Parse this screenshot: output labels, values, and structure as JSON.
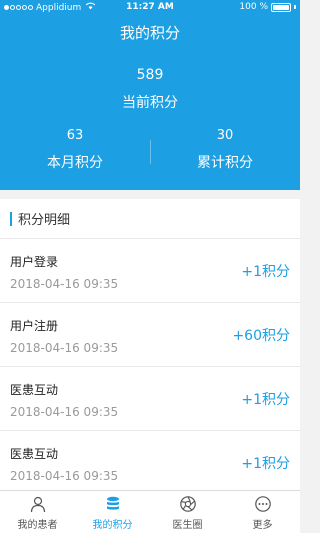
{
  "status_bar": {
    "carrier": "Applidium",
    "time": "11:27 AM",
    "battery_text": "100 %",
    "battery_level": 1.0
  },
  "header": {
    "title": "我的积分",
    "total_value": "589",
    "total_label": "当前积分",
    "monthly": {
      "value": "63",
      "label": "本月积分"
    },
    "cumulative": {
      "value": "30",
      "label": "累计积分"
    }
  },
  "details": {
    "section_title": "积分明细",
    "records": [
      {
        "type": "用户登录",
        "time": "2018-04-16  09:35",
        "points": "+1积分"
      },
      {
        "type": "用户注册",
        "time": "2018-04-16  09:35",
        "points": "+60积分"
      },
      {
        "type": "医患互动",
        "time": "2018-04-16  09:35",
        "points": "+1积分"
      },
      {
        "type": "医患互动",
        "time": "2018-04-16  09:35",
        "points": "+1积分"
      }
    ]
  },
  "tabbar": {
    "items": [
      {
        "label": "我的患者",
        "icon": "person-icon"
      },
      {
        "label": "我的积分",
        "icon": "coins-icon"
      },
      {
        "label": "医生圈",
        "icon": "aperture-icon"
      },
      {
        "label": "更多",
        "icon": "more-icon"
      }
    ],
    "active_index": 1
  },
  "colors": {
    "accent": "#1c9fe3",
    "header_bg": "#1c9fe3",
    "time_text": "#9a9a9a",
    "page_bg": "#f2f2f2"
  }
}
